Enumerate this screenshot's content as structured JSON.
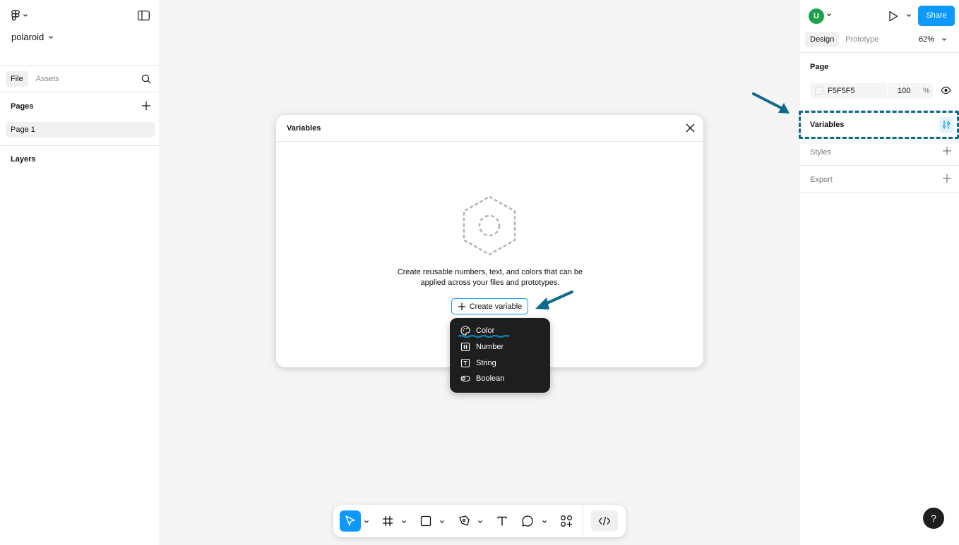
{
  "left_panel": {
    "file_name": "polaroid",
    "tabs": [
      {
        "label": "File"
      },
      {
        "label": "Assets"
      }
    ],
    "pages_title": "Pages",
    "pages": [
      {
        "label": "Page 1"
      }
    ],
    "layers_title": "Layers"
  },
  "right_panel": {
    "avatar_initial": "U",
    "share_label": "Share",
    "tabs": [
      {
        "label": "Design"
      },
      {
        "label": "Prototype"
      }
    ],
    "zoom": "62%",
    "page_title": "Page",
    "page_color_hex": "F5F5F5",
    "page_opacity": "100",
    "page_opacity_unit": "%",
    "variables_label": "Variables",
    "styles_label": "Styles",
    "export_label": "Export"
  },
  "dialog": {
    "title": "Variables",
    "empty_text": "Create reusable numbers, text, and colors that can be applied across your files and prototypes.",
    "create_button": "Create variable"
  },
  "menu": {
    "items": [
      {
        "label": "Color",
        "icon": "palette-icon"
      },
      {
        "label": "Number",
        "icon": "hash-icon"
      },
      {
        "label": "String",
        "icon": "text-icon"
      },
      {
        "label": "Boolean",
        "icon": "toggle-icon"
      }
    ]
  },
  "help_label": "?",
  "colors": {
    "accent": "#0d99ff",
    "annotation": "#0e6a8a",
    "avatar": "#1fa14b",
    "menu_bg": "#1e1e1e"
  }
}
